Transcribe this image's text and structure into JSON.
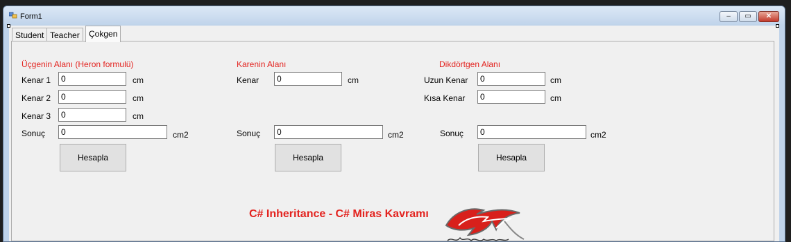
{
  "window": {
    "title": "Form1",
    "buttons": {
      "minimize": "‒",
      "maximize": "▭",
      "close": "✕"
    }
  },
  "tabs": [
    {
      "label": "Student"
    },
    {
      "label": "Teacher"
    },
    {
      "label": "Çokgen"
    }
  ],
  "active_tab": "Çokgen",
  "triangle": {
    "title": "Üçgenin Alanı (Heron formulü)",
    "side1_label": "Kenar 1",
    "side1_value": "0",
    "side1_unit": "cm",
    "side2_label": "Kenar 2",
    "side2_value": "0",
    "side2_unit": "cm",
    "side3_label": "Kenar 3",
    "side3_value": "0",
    "side3_unit": "cm",
    "result_label": "Sonuç",
    "result_value": "0",
    "result_unit": "cm2",
    "button": "Hesapla"
  },
  "square": {
    "title": "Karenin Alanı",
    "side_label": "Kenar",
    "side_value": "0",
    "side_unit": "cm",
    "result_label": "Sonuç",
    "result_value": "0",
    "result_unit": "cm2",
    "button": "Hesapla"
  },
  "rectangle": {
    "title": "Dikdörtgen Alanı",
    "long_label": "Uzun Kenar",
    "long_value": "0",
    "long_unit": "cm",
    "short_label": "Kısa Kenar",
    "short_value": "0",
    "short_unit": "cm",
    "result_label": "Sonuç",
    "result_value": "0",
    "result_unit": "cm2",
    "button": "Hesapla"
  },
  "caption": "C# Inheritance - C# Miras Kavramı",
  "logo": {
    "signature": "Mustafa Bahadır Bilaltmaz"
  },
  "colors": {
    "accent_red": "#e3231f",
    "client_bg": "#f0f0f0",
    "titlebar": "#bfd3ea"
  }
}
